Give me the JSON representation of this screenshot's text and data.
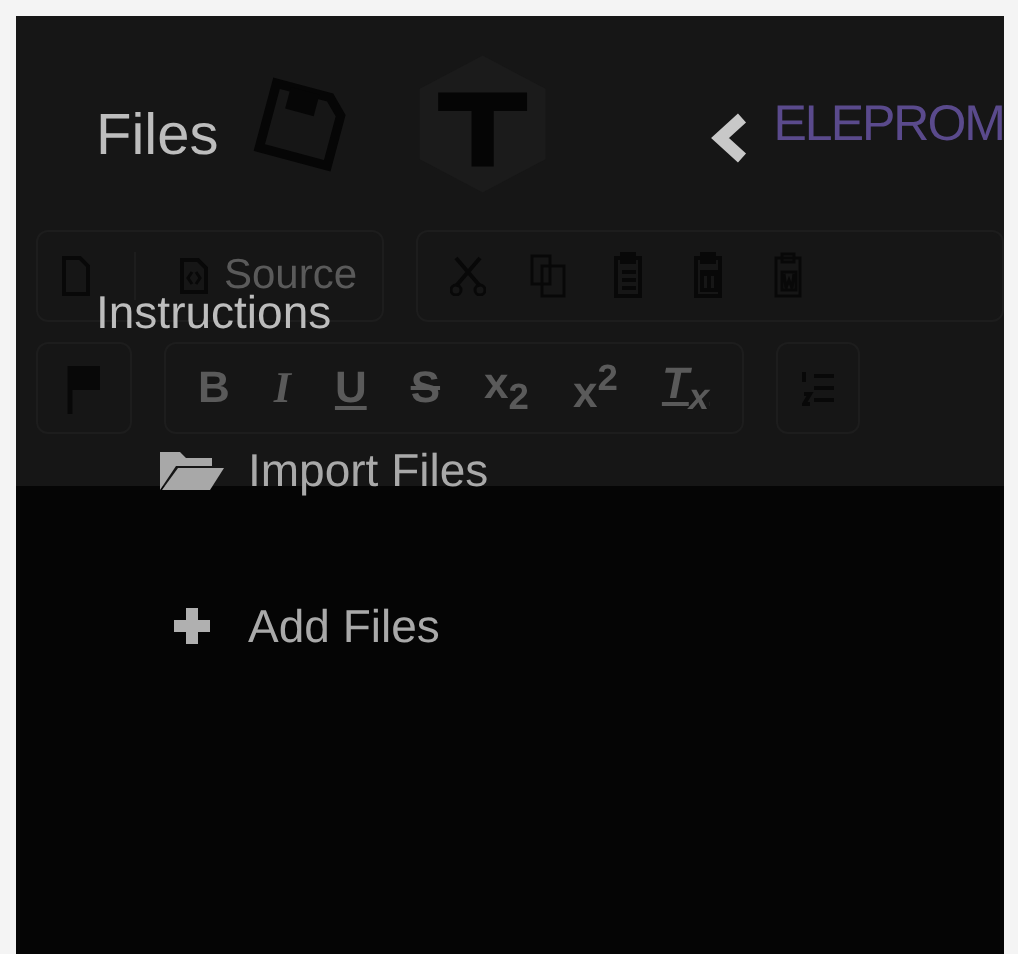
{
  "background_page": {
    "logo_text": "ELEPROM",
    "source_button": "Source",
    "format_buttons": [
      "B",
      "I",
      "U",
      "S",
      "x$_{2}$",
      "x$^{2}$",
      "T$_{x}$"
    ]
  },
  "menu": {
    "title": "Files",
    "section": "Instructions",
    "items": [
      {
        "kind": "import",
        "label": "Import Files"
      },
      {
        "kind": "add",
        "label": "Add Files"
      }
    ]
  }
}
